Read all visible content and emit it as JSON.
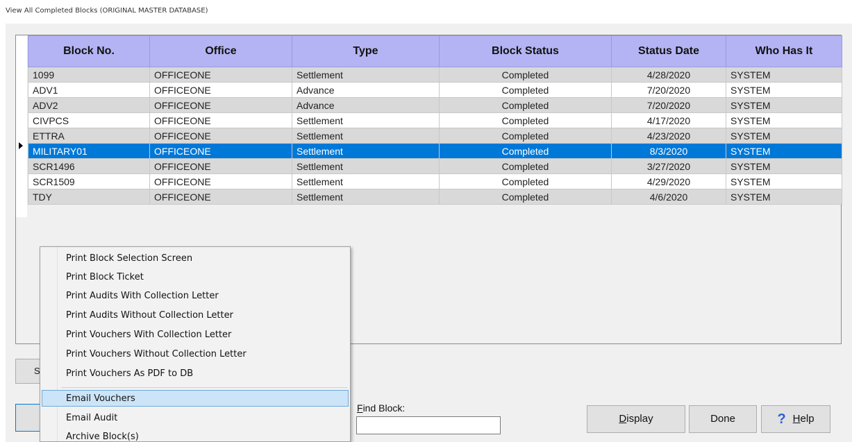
{
  "window": {
    "title": "View All Completed Blocks (ORIGINAL MASTER DATABASE)"
  },
  "grid": {
    "columns": [
      "Block No.",
      "Office",
      "Type",
      "Block Status",
      "Status Date",
      "Who Has It"
    ],
    "selected_row_index": 5,
    "rows": [
      [
        "1099",
        "OFFICEONE",
        "Settlement",
        "Completed",
        "4/28/2020",
        "SYSTEM"
      ],
      [
        "ADV1",
        "OFFICEONE",
        "Advance",
        "Completed",
        "7/20/2020",
        "SYSTEM"
      ],
      [
        "ADV2",
        "OFFICEONE",
        "Advance",
        "Completed",
        "7/20/2020",
        "SYSTEM"
      ],
      [
        "CIVPCS",
        "OFFICEONE",
        "Settlement",
        "Completed",
        "4/17/2020",
        "SYSTEM"
      ],
      [
        "ETTRA",
        "OFFICEONE",
        "Settlement",
        "Completed",
        "4/23/2020",
        "SYSTEM"
      ],
      [
        "MILITARY01",
        "OFFICEONE",
        "Settlement",
        "Completed",
        "8/3/2020",
        "SYSTEM"
      ],
      [
        "SCR1496",
        "OFFICEONE",
        "Settlement",
        "Completed",
        "3/27/2020",
        "SYSTEM"
      ],
      [
        "SCR1509",
        "OFFICEONE",
        "Settlement",
        "Completed",
        "4/29/2020",
        "SYSTEM"
      ],
      [
        "TDY",
        "OFFICEONE",
        "Settlement",
        "Completed",
        "4/6/2020",
        "SYSTEM"
      ]
    ]
  },
  "context_menu": {
    "items": [
      "Print Block Selection Screen",
      "Print Block Ticket",
      "Print Audits With Collection Letter",
      "Print Audits Without Collection Letter",
      "Print Vouchers With Collection Letter",
      "Print Vouchers Without Collection Letter",
      "Print Vouchers As PDF to DB",
      "Email Vouchers",
      "Email Audit",
      "Archive Block(s)"
    ],
    "highlighted_index": 7
  },
  "find": {
    "label_prefix": "",
    "label_accel": "F",
    "label_rest": "ind Block:",
    "value": ""
  },
  "buttons": {
    "partial_left": "S",
    "display_accel": "D",
    "display_rest": "isplay",
    "done": "Done",
    "help_icon": "?",
    "help_accel": "H",
    "help_rest": "elp"
  },
  "colors": {
    "header_bg": "#b4b4f4",
    "selection_bg": "#0078d7",
    "alt_row_bg": "#d9d9d9",
    "menu_highlight": "#cce4f7"
  },
  "icons": {
    "row_indicator": "row-pointer-icon",
    "help": "help-question-icon"
  }
}
